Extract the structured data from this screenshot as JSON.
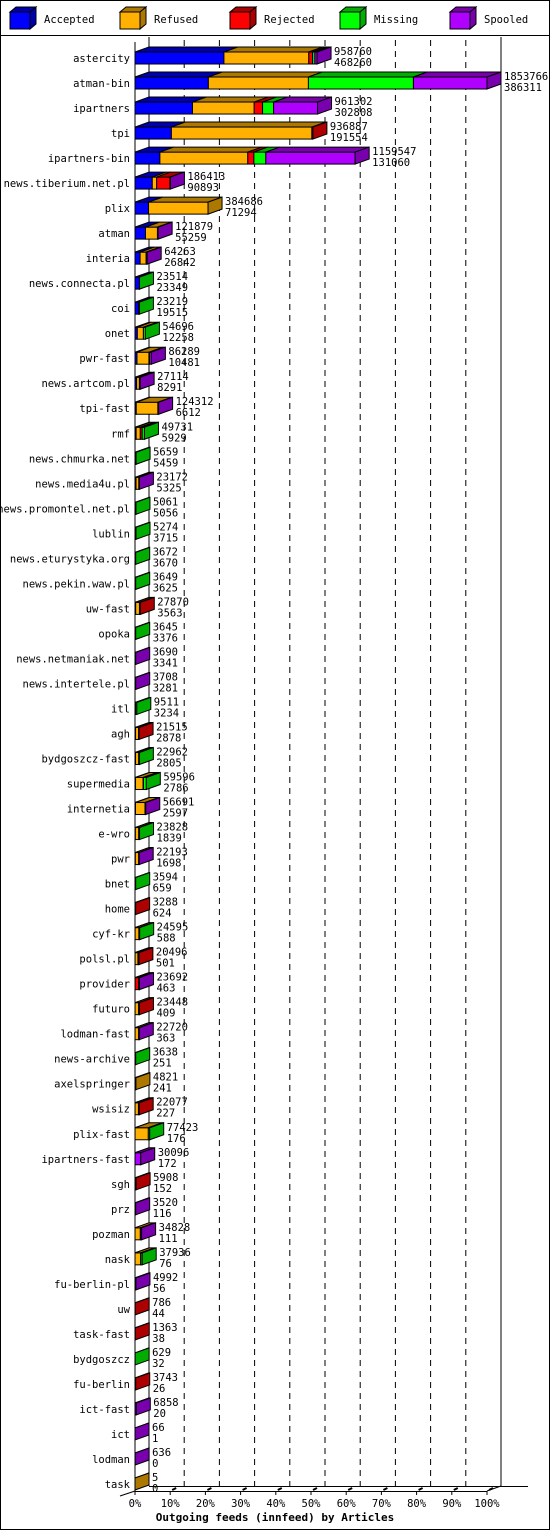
{
  "chart_data": {
    "type": "bar",
    "orientation": "horizontal",
    "stacked": true,
    "title": "Outgoing feeds (innfeed) by Articles",
    "legend_position": "top",
    "grid": true,
    "xlim": [
      0,
      100
    ],
    "x_ticks": [
      "0%",
      "10%",
      "20%",
      "30%",
      "40%",
      "50%",
      "60%",
      "70%",
      "80%",
      "90%",
      "100%"
    ],
    "series": [
      {
        "name": "Accepted",
        "color": "#0000ff"
      },
      {
        "name": "Refused",
        "color": "#ffb000"
      },
      {
        "name": "Rejected",
        "color": "#ff0000"
      },
      {
        "name": "Missing",
        "color": "#00ff00"
      },
      {
        "name": "Spooled",
        "color": "#b000ff"
      }
    ],
    "rows": [
      {
        "name": "astercity",
        "offered": 958760,
        "accepted": 468260,
        "segments": [
          468260,
          447000,
          20000,
          12000,
          11500
        ]
      },
      {
        "name": "atman-bin",
        "offered": 1853766,
        "accepted": 386311,
        "segments": [
          386311,
          527000,
          0,
          553000,
          387455
        ]
      },
      {
        "name": "ipartners",
        "offered": 961302,
        "accepted": 302808,
        "segments": [
          302808,
          325000,
          44000,
          58000,
          231494
        ]
      },
      {
        "name": "tpi",
        "offered": 936887,
        "accepted": 191554,
        "segments": [
          191554,
          740000,
          5333,
          0,
          0
        ]
      },
      {
        "name": "ipartners-bin",
        "offered": 1159547,
        "accepted": 131060,
        "segments": [
          131060,
          463000,
          32000,
          63000,
          470487
        ]
      },
      {
        "name": "news.tiberium.net.pl",
        "offered": 186413,
        "accepted": 90893,
        "segments": [
          90893,
          23000,
          70000,
          0,
          2520
        ]
      },
      {
        "name": "plix",
        "offered": 384686,
        "accepted": 71294,
        "segments": [
          71294,
          313392,
          0,
          0,
          0
        ]
      },
      {
        "name": "atman",
        "offered": 121879,
        "accepted": 55259,
        "segments": [
          55259,
          63000,
          0,
          0,
          3620
        ]
      },
      {
        "name": "interia",
        "offered": 64263,
        "accepted": 26842,
        "segments": [
          26842,
          32000,
          0,
          0,
          5421
        ]
      },
      {
        "name": "news.connecta.pl",
        "offered": 23514,
        "accepted": 23349,
        "segments": [
          23349,
          0,
          0,
          165,
          0
        ]
      },
      {
        "name": "coi",
        "offered": 23219,
        "accepted": 19515,
        "segments": [
          19515,
          0,
          0,
          3704,
          0
        ]
      },
      {
        "name": "onet",
        "offered": 54696,
        "accepted": 12258,
        "segments": [
          12258,
          32000,
          0,
          10438,
          0
        ]
      },
      {
        "name": "pwr-fast",
        "offered": 86289,
        "accepted": 10481,
        "segments": [
          10481,
          63000,
          3000,
          0,
          9808
        ]
      },
      {
        "name": "news.artcom.pl",
        "offered": 27114,
        "accepted": 8291,
        "segments": [
          8291,
          15000,
          0,
          0,
          3823
        ]
      },
      {
        "name": "tpi-fast",
        "offered": 124312,
        "accepted": 6612,
        "segments": [
          6612,
          114000,
          0,
          0,
          3700
        ]
      },
      {
        "name": "rmf",
        "offered": 49731,
        "accepted": 5929,
        "segments": [
          5929,
          22000,
          10000,
          11802,
          0
        ]
      },
      {
        "name": "news.chmurka.net",
        "offered": 5659,
        "accepted": 5459,
        "segments": [
          5459,
          0,
          0,
          200,
          0
        ]
      },
      {
        "name": "news.media4u.pl",
        "offered": 23172,
        "accepted": 5325,
        "segments": [
          5325,
          15000,
          0,
          0,
          2847
        ]
      },
      {
        "name": "news.promontel.net.pl",
        "offered": 5061,
        "accepted": 5056,
        "segments": [
          5056,
          0,
          0,
          5,
          0
        ]
      },
      {
        "name": "lublin",
        "offered": 5274,
        "accepted": 3715,
        "segments": [
          3715,
          0,
          0,
          1559,
          0
        ]
      },
      {
        "name": "news.eturystyka.org",
        "offered": 3672,
        "accepted": 3670,
        "segments": [
          3670,
          0,
          0,
          2,
          0
        ]
      },
      {
        "name": "news.pekin.waw.pl",
        "offered": 3649,
        "accepted": 3625,
        "segments": [
          3625,
          0,
          0,
          24,
          0
        ]
      },
      {
        "name": "uw-fast",
        "offered": 27870,
        "accepted": 3563,
        "segments": [
          3563,
          20000,
          4307,
          0,
          0
        ]
      },
      {
        "name": "opoka",
        "offered": 3645,
        "accepted": 3376,
        "segments": [
          3376,
          0,
          0,
          269,
          0
        ]
      },
      {
        "name": "news.netmaniak.net",
        "offered": 3690,
        "accepted": 3341,
        "segments": [
          3341,
          0,
          0,
          0,
          349
        ]
      },
      {
        "name": "news.intertele.pl",
        "offered": 3708,
        "accepted": 3281,
        "segments": [
          3281,
          0,
          0,
          0,
          427
        ]
      },
      {
        "name": "itl",
        "offered": 9511,
        "accepted": 3234,
        "segments": [
          3234,
          0,
          0,
          6277,
          0
        ]
      },
      {
        "name": "agh",
        "offered": 21515,
        "accepted": 2878,
        "segments": [
          2878,
          16000,
          2637,
          0,
          0
        ]
      },
      {
        "name": "bydgoszcz-fast",
        "offered": 22962,
        "accepted": 2805,
        "segments": [
          2805,
          17000,
          0,
          3157,
          0
        ]
      },
      {
        "name": "supermedia",
        "offered": 59596,
        "accepted": 2786,
        "segments": [
          2786,
          40000,
          2000,
          14810,
          0
        ]
      },
      {
        "name": "internetia",
        "offered": 56691,
        "accepted": 2597,
        "segments": [
          2597,
          50000,
          0,
          0,
          4094
        ]
      },
      {
        "name": "e-wro",
        "offered": 23828,
        "accepted": 1839,
        "segments": [
          1839,
          18000,
          0,
          3989,
          0
        ]
      },
      {
        "name": "pwr",
        "offered": 22193,
        "accepted": 1698,
        "segments": [
          1698,
          18000,
          0,
          0,
          2495
        ]
      },
      {
        "name": "bnet",
        "offered": 3594,
        "accepted": 659,
        "segments": [
          659,
          0,
          0,
          2935,
          0
        ]
      },
      {
        "name": "home",
        "offered": 3288,
        "accepted": 624,
        "segments": [
          624,
          0,
          2664,
          0,
          0
        ]
      },
      {
        "name": "cyf-kr",
        "offered": 24595,
        "accepted": 588,
        "segments": [
          588,
          20000,
          0,
          4007,
          0
        ]
      },
      {
        "name": "polsl.pl",
        "offered": 20496,
        "accepted": 501,
        "segments": [
          501,
          15000,
          4995,
          0,
          0
        ]
      },
      {
        "name": "provider",
        "offered": 23692,
        "accepted": 463,
        "segments": [
          463,
          0,
          19000,
          0,
          4229
        ]
      },
      {
        "name": "futuro",
        "offered": 23448,
        "accepted": 409,
        "segments": [
          409,
          19000,
          4039,
          0,
          0
        ]
      },
      {
        "name": "lodman-fast",
        "offered": 22720,
        "accepted": 363,
        "segments": [
          363,
          19000,
          0,
          0,
          3357
        ]
      },
      {
        "name": "news-archive",
        "offered": 3638,
        "accepted": 251,
        "segments": [
          251,
          0,
          0,
          3387,
          0
        ]
      },
      {
        "name": "axelspringer",
        "offered": 4821,
        "accepted": 241,
        "segments": [
          241,
          4580,
          0,
          0,
          0
        ]
      },
      {
        "name": "wsisiz",
        "offered": 22077,
        "accepted": 227,
        "segments": [
          227,
          18000,
          3850,
          0,
          0
        ]
      },
      {
        "name": "plix-fast",
        "offered": 77423,
        "accepted": 176,
        "segments": [
          176,
          70000,
          0,
          7247,
          0
        ]
      },
      {
        "name": "ipartners-fast",
        "offered": 30096,
        "accepted": 172,
        "segments": [
          172,
          0,
          0,
          0,
          29924
        ]
      },
      {
        "name": "sgh",
        "offered": 5908,
        "accepted": 152,
        "segments": [
          152,
          0,
          5756,
          0,
          0
        ]
      },
      {
        "name": "prz",
        "offered": 3520,
        "accepted": 116,
        "segments": [
          116,
          0,
          0,
          0,
          3404
        ]
      },
      {
        "name": "pozman",
        "offered": 34828,
        "accepted": 111,
        "segments": [
          111,
          28000,
          0,
          0,
          6717
        ]
      },
      {
        "name": "nask",
        "offered": 37936,
        "accepted": 76,
        "segments": [
          76,
          30000,
          0,
          7860,
          0
        ]
      },
      {
        "name": "fu-berlin-pl",
        "offered": 4992,
        "accepted": 56,
        "segments": [
          56,
          0,
          0,
          0,
          4936
        ]
      },
      {
        "name": "uw",
        "offered": 786,
        "accepted": 44,
        "segments": [
          44,
          0,
          742,
          0,
          0
        ]
      },
      {
        "name": "task-fast",
        "offered": 1363,
        "accepted": 38,
        "segments": [
          38,
          0,
          1325,
          0,
          0
        ]
      },
      {
        "name": "bydgoszcz",
        "offered": 629,
        "accepted": 32,
        "segments": [
          32,
          0,
          0,
          597,
          0
        ]
      },
      {
        "name": "fu-berlin",
        "offered": 3743,
        "accepted": 26,
        "segments": [
          26,
          0,
          3717,
          0,
          0
        ]
      },
      {
        "name": "ict-fast",
        "offered": 6858,
        "accepted": 20,
        "segments": [
          20,
          0,
          0,
          0,
          6838
        ]
      },
      {
        "name": "ict",
        "offered": 66,
        "accepted": 1,
        "segments": [
          1,
          0,
          0,
          0,
          65
        ]
      },
      {
        "name": "lodman",
        "offered": 636,
        "accepted": 0,
        "segments": [
          0,
          0,
          0,
          0,
          636
        ]
      },
      {
        "name": "task",
        "offered": 5,
        "accepted": 0,
        "segments": [
          0,
          5,
          0,
          0,
          0
        ]
      }
    ]
  }
}
